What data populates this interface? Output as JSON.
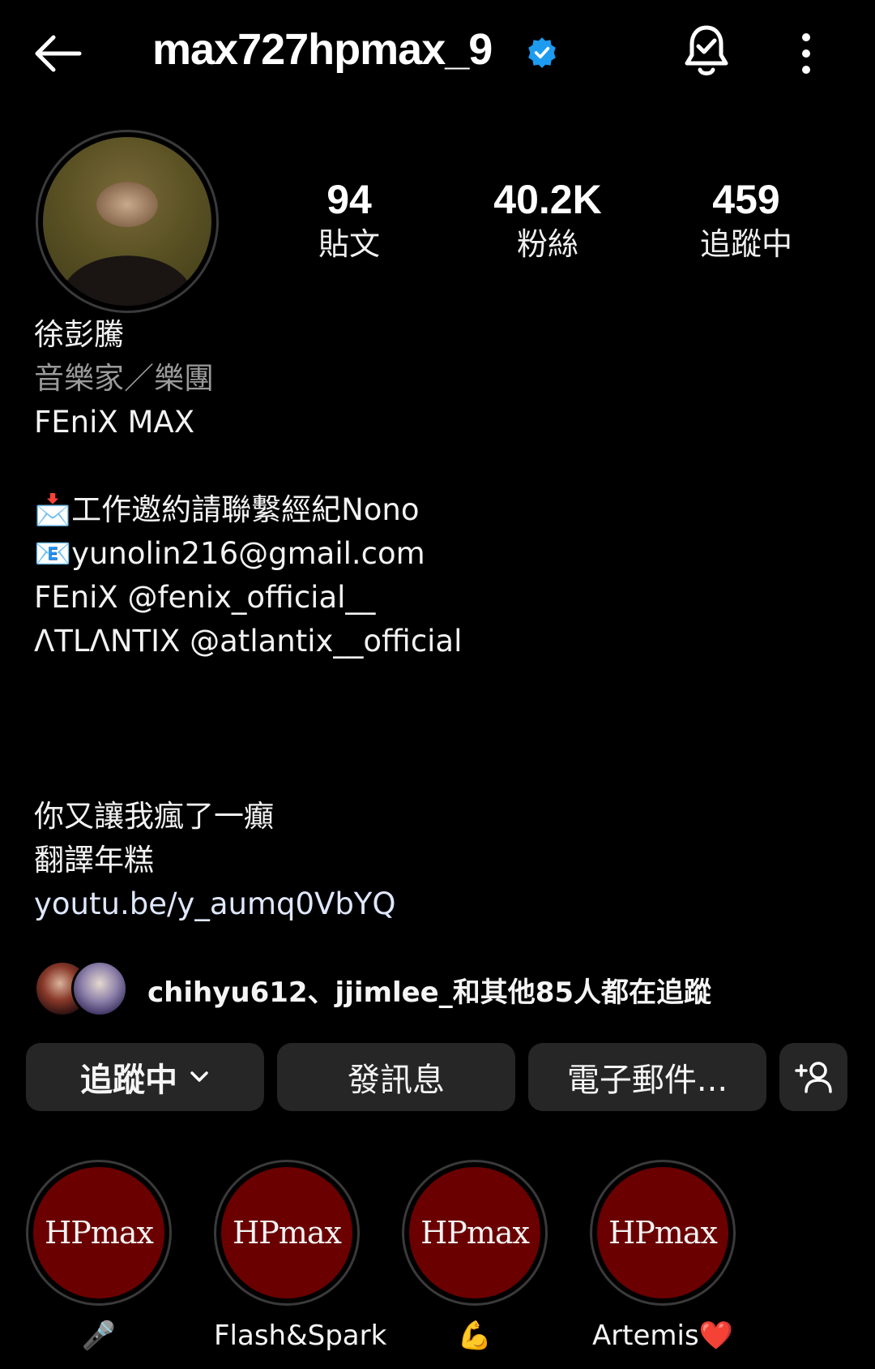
{
  "header": {
    "username": "max727hpmax_9",
    "back_icon": "arrow-left-icon",
    "verified_icon": "verified-badge-icon",
    "verified_color": "#1d9bf0",
    "bell_icon": "notification-bell-icon",
    "more_icon": "more-vertical-icon"
  },
  "stats": {
    "posts": {
      "value": "94",
      "label": "貼文"
    },
    "followers": {
      "value": "40.2K",
      "label": "粉絲"
    },
    "following": {
      "value": "459",
      "label": "追蹤中"
    }
  },
  "bio": {
    "name": "徐彭騰",
    "category": "音樂家／樂團",
    "line1": "FEniX MAX",
    "line2": "📩工作邀約請聯繫經紀Nono",
    "line3": "📧yunolin216@gmail.com",
    "line4": "FEniX @fenix_official__",
    "line5": "ΛTLΛNTIX @atlantix__official",
    "line6": "你又讓我瘋了一癲",
    "line7": "翻譯年糕",
    "link": "youtu.be/y_aumq0VbYQ"
  },
  "followed_by": {
    "text": "chihyu612、jjimlee_和其他85人都在追蹤"
  },
  "buttons": {
    "following": "追蹤中",
    "message": "發訊息",
    "email": "電子郵件...",
    "add_user_icon": "add-user-icon"
  },
  "highlights": [
    {
      "cover": "HPmax",
      "label": "🎤"
    },
    {
      "cover": "HPmax",
      "label": "Flash&Spark"
    },
    {
      "cover": "HPmax",
      "label": "💪"
    },
    {
      "cover": "HPmax",
      "label": "Artemis❤️"
    }
  ],
  "colors": {
    "background": "#000000",
    "button_bg": "#262626",
    "highlight_red": "#6b0000",
    "muted_text": "#9a9a9a"
  }
}
